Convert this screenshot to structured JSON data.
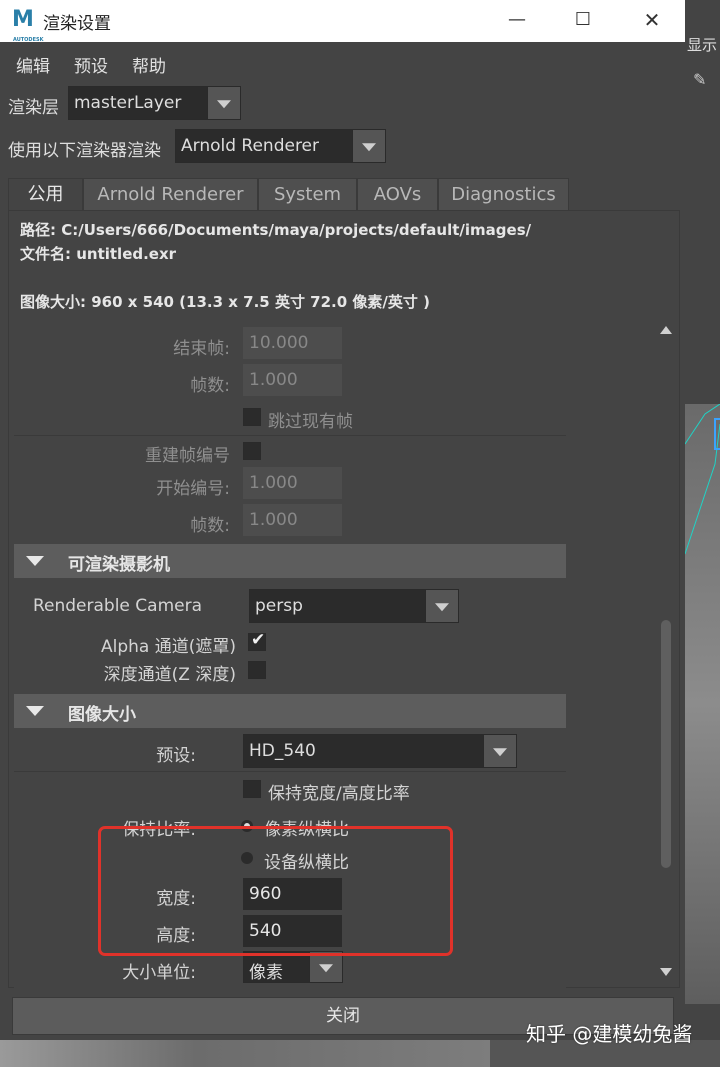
{
  "window": {
    "title": "渲染设置",
    "app_icon": "maya-icon"
  },
  "menu": {
    "edit": "编辑",
    "presets": "预设",
    "help": "帮助"
  },
  "render_layer": {
    "label": "渲染层",
    "value": "masterLayer"
  },
  "renderer": {
    "label": "使用以下渲染器渲染",
    "value": "Arnold Renderer"
  },
  "tabs": [
    "公用",
    "Arnold Renderer",
    "System",
    "AOVs",
    "Diagnostics"
  ],
  "info": {
    "path": "路径: C:/Users/666/Documents/maya/projects/default/images/",
    "filename": "文件名: untitled.exr",
    "image_size": "图像大小: 960 x 540 (13.3 x 7.5 英寸 72.0 像素/英寸 )"
  },
  "frame_range": {
    "end_frame_label": "结束帧:",
    "end_frame_value": "10.000",
    "by_frame_label": "帧数:",
    "by_frame_value": "1.000",
    "skip_existing_label": "跳过现有帧",
    "renumber_label": "重建帧编号",
    "start_number_label": "开始编号:",
    "start_number_value": "1.000",
    "by_frame2_label": "帧数:",
    "by_frame2_value": "1.000"
  },
  "camera_section": {
    "title": "可渲染摄影机",
    "renderable_camera_label": "Renderable Camera",
    "renderable_camera_value": "persp",
    "alpha_label": "Alpha 通道(遮罩)",
    "alpha_checked": true,
    "depth_label": "深度通道(Z 深度)",
    "depth_checked": false
  },
  "image_size_section": {
    "title": "图像大小",
    "preset_label": "预设:",
    "preset_value": "HD_540",
    "maintain_ratio_label": "保持宽度/高度比率",
    "keep_ratio_label": "保持比率:",
    "pixel_aspect_label": "像素纵横比",
    "device_aspect_label": "设备纵横比",
    "width_label": "宽度:",
    "width_value": "960",
    "height_label": "高度:",
    "height_value": "540",
    "size_units_label": "大小单位:",
    "size_units_value": "像素"
  },
  "close_button": "关闭",
  "watermark": "知乎 @建模幼兔酱",
  "background": {
    "right_label": "显示"
  },
  "colors": {
    "highlight_box": "#e0322a",
    "panel": "#444444",
    "field_dark": "#2b2b2b"
  }
}
